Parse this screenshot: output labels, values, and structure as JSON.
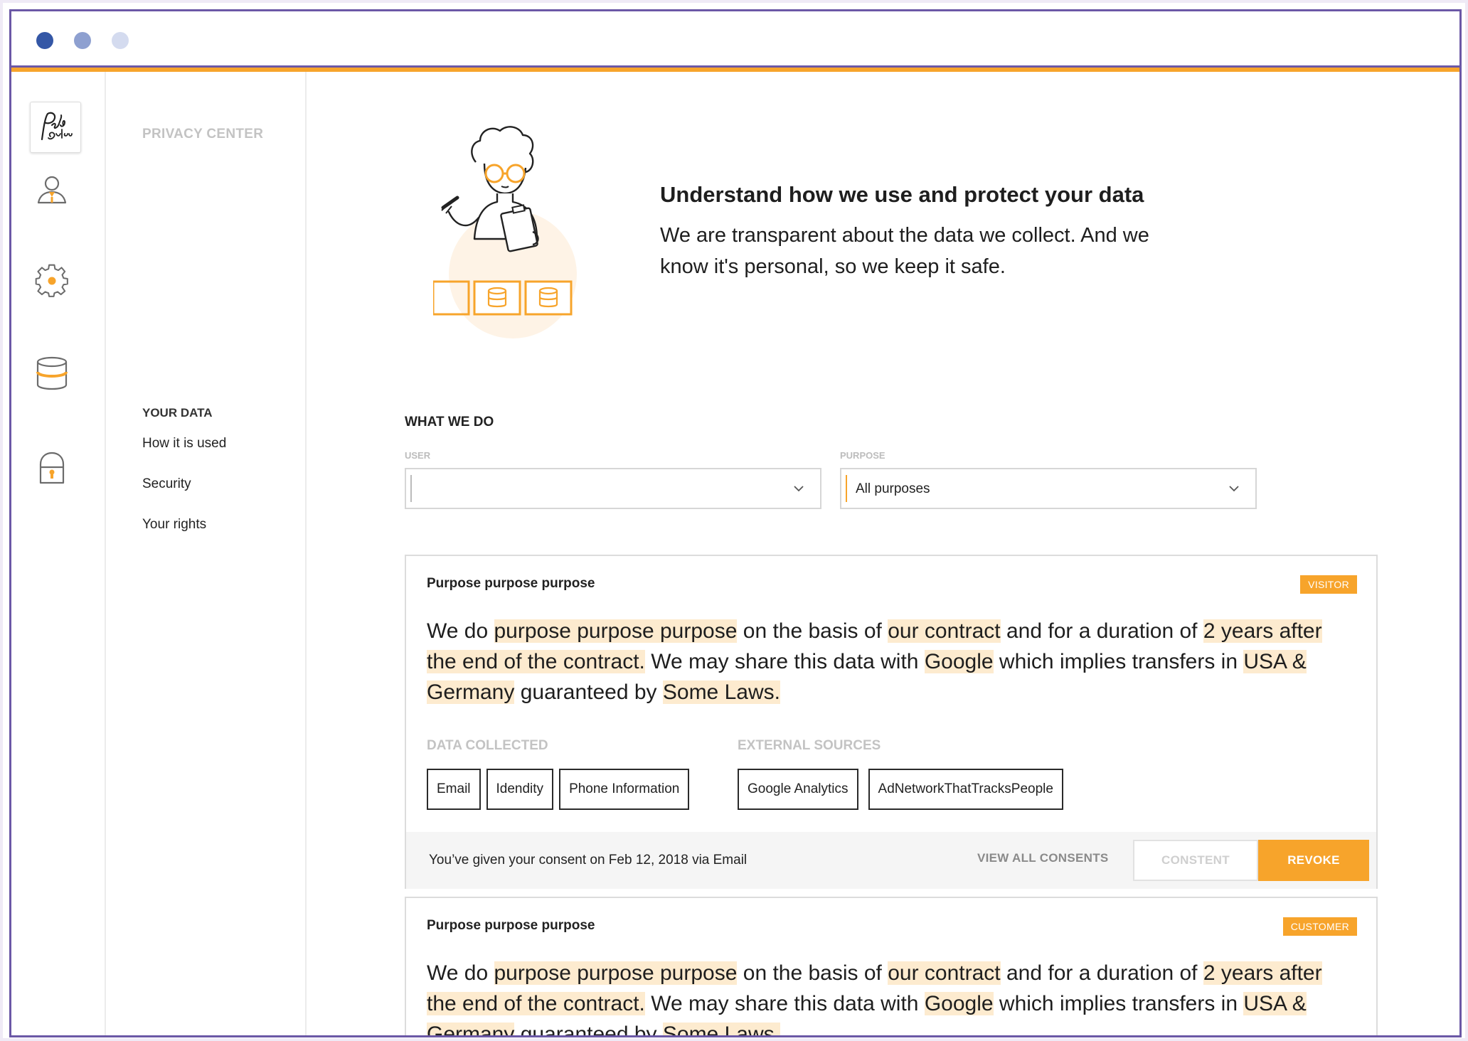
{
  "window": {
    "dots": [
      "#3457a6",
      "#8ea0d0",
      "#d4dbef"
    ]
  },
  "colors": {
    "accent": "#f7a42b",
    "frame": "#6b58a6",
    "highlight": "#fdebcf"
  },
  "rail": {
    "logo_text": "Pelo Studio",
    "icons": [
      "user-icon",
      "settings-gear-icon",
      "database-icon",
      "lock-icon"
    ]
  },
  "nav": {
    "privacy_center": "PRIVACY CENTER",
    "section_title": "YOUR DATA",
    "links": [
      "How it is used",
      "Security",
      "Your rights"
    ]
  },
  "hero": {
    "title": "Understand how we use and protect your data",
    "text": "We are transparent about the data we collect. And we know it's personal, so we keep it safe."
  },
  "what_we_do": {
    "title": "WHAT WE DO",
    "user_label": "USER",
    "user_value": "",
    "purpose_label": "PURPOSE",
    "purpose_value": "All purposes"
  },
  "cards": [
    {
      "title": "Purpose purpose purpose",
      "badge": "VISITOR",
      "text": {
        "p1": "We do ",
        "h1": "purpose purpose purpose",
        "p2": " on the basis of ",
        "h2": "our contract",
        "p3": " and for a duration of ",
        "h3": "2 years after the end of the contract.",
        "p4": " We may share this data with ",
        "h4": "Google",
        "p5": " which implies transfers in ",
        "h5": "USA & Germany",
        "p6": " guaranteed by ",
        "h6": "Some Laws. "
      },
      "data_collected_label": "DATA COLLECTED",
      "data_collected": [
        "Email",
        "Idendity",
        "Phone Information"
      ],
      "external_sources_label": "EXTERNAL SOURCES",
      "external_sources": [
        "Google Analytics",
        "AdNetworkThatTracksPeople"
      ],
      "consent_text": "You’ve given your consent on Feb 12, 2018 via Email",
      "view_all": "VIEW ALL CONSENTS",
      "consent_button": "CONSTENT",
      "revoke_button": "REVOKE"
    },
    {
      "title": "Purpose purpose purpose",
      "badge": "CUSTOMER",
      "text": {
        "p1": "We do ",
        "h1": "purpose purpose purpose",
        "p2": " on the basis of ",
        "h2": "our contract",
        "p3": " and for a duration of ",
        "h3": "2 years after the end of the contract.",
        "p4": " We may share this data with ",
        "h4": "Google",
        "p5": " which implies transfers in ",
        "h5": "USA & Germany",
        "p6": " guaranteed by ",
        "h6": "Some Laws. "
      }
    }
  ]
}
